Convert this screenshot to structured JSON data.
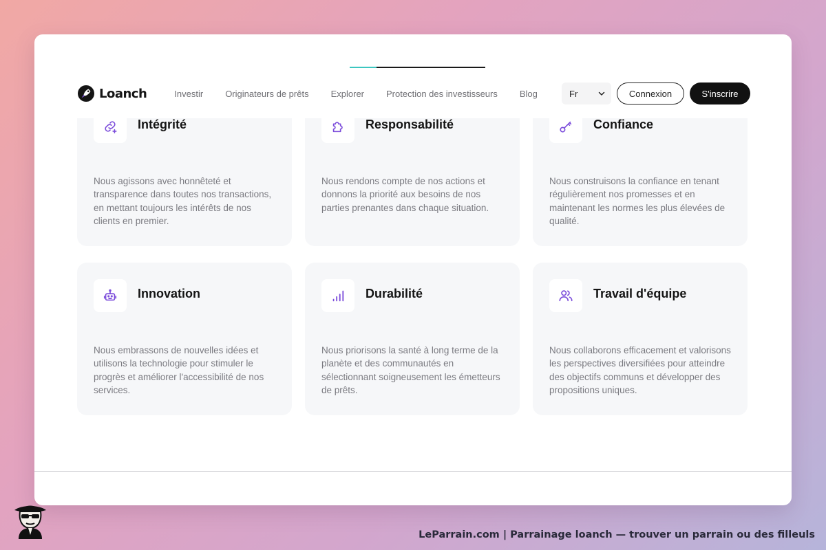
{
  "page": {
    "progress_percent": 20
  },
  "header": {
    "brand_name": "Loanch",
    "brand_icon": "rocket-icon",
    "menu": [
      {
        "label": "Investir"
      },
      {
        "label": "Originateurs de prêts"
      },
      {
        "label": "Explorer"
      },
      {
        "label": "Protection des investisseurs"
      },
      {
        "label": "Blog"
      }
    ],
    "language": {
      "selected": "Fr",
      "icon": "chevron-down-icon"
    },
    "login_label": "Connexion",
    "signup_label": "S'inscrire"
  },
  "values": [
    {
      "title": "Intégrité",
      "icon": "link-icon",
      "description": "Nous agissons avec honnêteté et transparence dans toutes nos transactions, en mettant toujours les intérêts de nos clients en premier."
    },
    {
      "title": "Responsabilité",
      "icon": "puzzle-icon",
      "description": "Nous rendons compte de nos actions et donnons la priorité aux besoins de nos parties prenantes dans chaque situation."
    },
    {
      "title": "Confiance",
      "icon": "key-icon",
      "description": "Nous construisons la confiance en tenant régulièrement nos promesses et en maintenant les normes les plus élevées de qualité."
    },
    {
      "title": "Innovation",
      "icon": "robot-icon",
      "description": "Nous embrassons de nouvelles idées et utilisons la technologie pour stimuler le progrès et améliorer l'accessibilité de nos services."
    },
    {
      "title": "Durabilité",
      "icon": "bar-chart-icon",
      "description": "Nous priorisons la santé à long terme de la planète et des communautés en sélectionnant soigneusement les émetteurs de prêts."
    },
    {
      "title": "Travail d'équipe",
      "icon": "users-icon",
      "description": "Nous collaborons efficacement et valorisons les perspectives diversifiées pour atteindre des objectifs communs et développer des propositions uniques."
    }
  ],
  "footer": {
    "mascot_icon": "spy-mascot-icon",
    "credit": "LeParrain.com | Parrainage loanch — trouver un parrain ou des filleuls"
  },
  "colors": {
    "accent_purple": "#7c4ddb",
    "progress_teal": "#3cc6c0",
    "card_background": "#f6f7f9",
    "primary_button": "#111111"
  }
}
